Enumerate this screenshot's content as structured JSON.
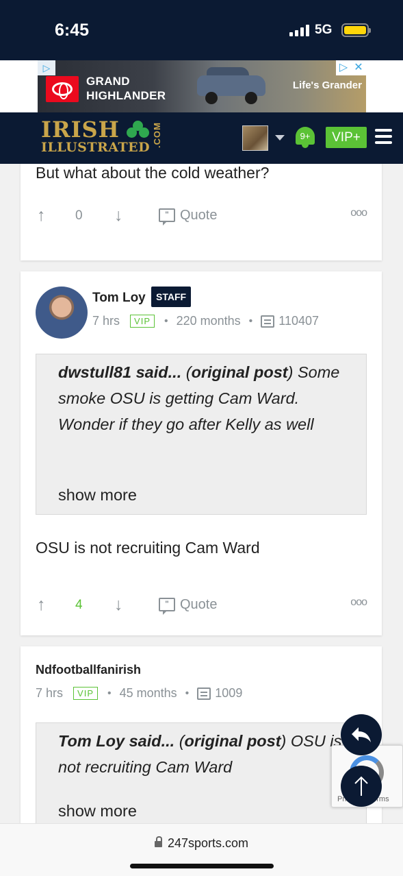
{
  "status_bar": {
    "time": "6:45",
    "network": "5G"
  },
  "ad": {
    "model": "GRAND\nHIGHLANDER",
    "tagline": "Life's Grander",
    "adchoices_icon": "adchoices-icon",
    "close_icon": "close-icon"
  },
  "header": {
    "logo_line1": "IRISH",
    "logo_line2": "ILLUSTRATED",
    "logo_dotcom": ".COM",
    "notifications_count": "9+",
    "vip_label": "VIP+",
    "accent_color": "#5bc236",
    "navy_color": "#0b1a33"
  },
  "posts": [
    {
      "text": "But what about the cold weather?",
      "votes": "0",
      "quote_label": "Quote",
      "more_icon": "ooo"
    },
    {
      "author": "Tom Loy",
      "badge": "STAFF",
      "time": "7 hrs",
      "vip": "VIP",
      "tenure": "220 months",
      "post_count": "110407",
      "quote_author": "dwstull81 said...",
      "quote_link": "original post",
      "quote_text": "Some smoke OSU is getting Cam Ward. Wonder if they go after Kelly as well",
      "show_more": "show more",
      "text": "OSU is not recruiting Cam Ward",
      "votes": "4",
      "quote_label": "Quote",
      "more_icon": "ooo"
    },
    {
      "author": "Ndfootballfanirish",
      "time": "7 hrs",
      "vip": "VIP",
      "tenure": "45 months",
      "post_count": "1009",
      "quote_author": "Tom Loy said...",
      "quote_link": "original post",
      "quote_text": "OSU is not recruiting Cam Ward",
      "show_more": "show more"
    }
  ],
  "recaptcha": {
    "text": "Privacy - Terms"
  },
  "browser": {
    "url": "247sports.com"
  }
}
